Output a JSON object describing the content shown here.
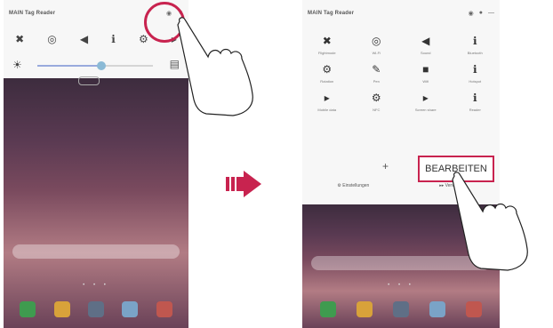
{
  "left_phone": {
    "carrier": "MAIN Tag Reader",
    "status_icons": [
      "◉",
      "▼"
    ],
    "quick_icons": [
      "✖",
      "◎",
      "◀",
      "ℹ",
      "⚙",
      "▸"
    ],
    "brightness": {
      "sun": "☀",
      "level": 0.55,
      "auto": "▤"
    },
    "dots": "• • •",
    "dock_apps": [
      "phone",
      "contacts",
      "camera",
      "gallery",
      "chrome"
    ]
  },
  "arrow": "▶",
  "right_phone": {
    "carrier": "MAIN Tag Reader",
    "status_icons": [
      "◉",
      "●",
      "—"
    ],
    "tiles": [
      {
        "icon": "✖",
        "label": "Flightmode"
      },
      {
        "icon": "◎",
        "label": "Wi-Fi"
      },
      {
        "icon": "◀",
        "label": "Sound"
      },
      {
        "icon": "ℹ",
        "label": "Bluetooth"
      },
      {
        "icon": "⚙",
        "label": "Rotation"
      },
      {
        "icon": "✎",
        "label": "Pen"
      },
      {
        "icon": "■",
        "label": "Wifi"
      },
      {
        "icon": "ℹ",
        "label": "Hotspot"
      },
      {
        "icon": "▸",
        "label": "Mobile data"
      },
      {
        "icon": "⚙",
        "label": "NFC"
      },
      {
        "icon": "▸",
        "label": "Screen share"
      },
      {
        "icon": "ℹ",
        "label": "Reader"
      }
    ],
    "plus": "+",
    "edit_label": "BEARBEITEN",
    "bottom_links": [
      "⚙  Einstellungen",
      "▸▸  Verwalten"
    ],
    "dots": "• • •",
    "dock_apps": [
      "phone",
      "contacts",
      "camera",
      "gallery",
      "chrome"
    ]
  },
  "colors": {
    "highlight": "#c8234f",
    "accent": "#c8234f"
  }
}
